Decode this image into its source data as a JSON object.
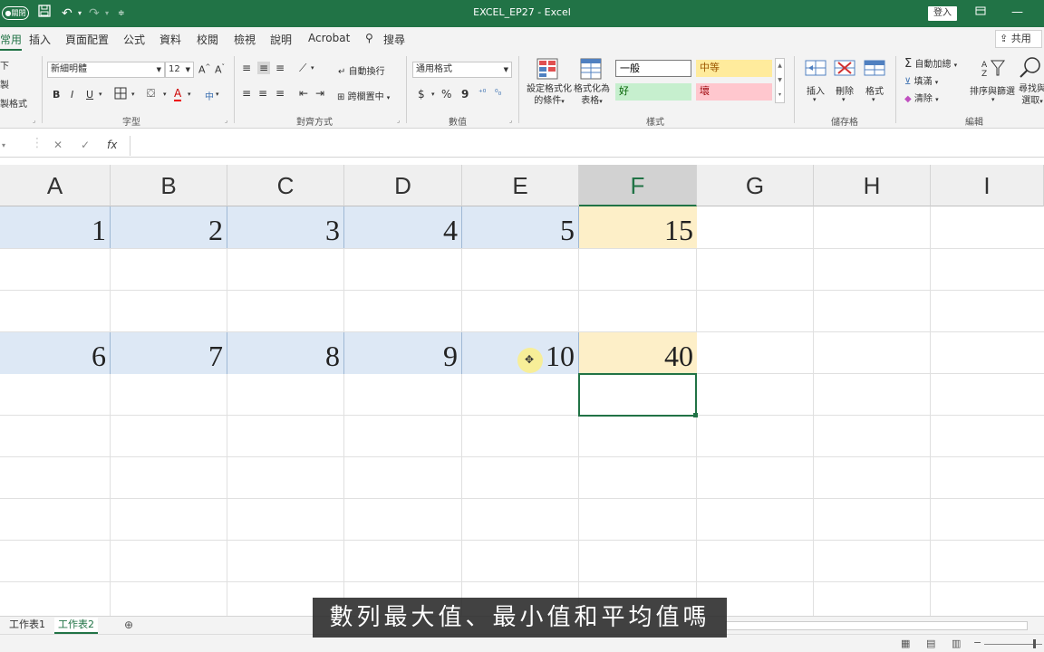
{
  "titlebar": {
    "autosave_label": "●關閉",
    "title": "EXCEL_EP27 - Excel",
    "signin": "登入"
  },
  "tabs": [
    {
      "label": "常用"
    },
    {
      "label": "插入"
    },
    {
      "label": "頁面配置"
    },
    {
      "label": "公式"
    },
    {
      "label": "資料"
    },
    {
      "label": "校閱"
    },
    {
      "label": "檢視"
    },
    {
      "label": "說明"
    },
    {
      "label": "Acrobat"
    },
    {
      "label": "搜尋"
    }
  ],
  "share_label": "共用",
  "ribbon": {
    "clipboard": {
      "paste_short": "下",
      "copy_short": "製",
      "format_painter_short": "製格式"
    },
    "font": {
      "font_name": "新細明體",
      "font_size": "12",
      "grow": "A^",
      "shrink": "A˅",
      "bold": "B",
      "italic": "I",
      "underline": "U",
      "color_a": "A",
      "phonetic": "中",
      "label": "字型"
    },
    "alignment": {
      "wrap": "自動換行",
      "merge": "跨欄置中",
      "label": "對齊方式"
    },
    "number": {
      "format": "通用格式",
      "currency": "$",
      "percent": "%",
      "comma": "9",
      "label": "數值"
    },
    "styles": {
      "conditional": [
        "設定格式化",
        "的條件"
      ],
      "as_table": [
        "格式化為",
        "表格"
      ],
      "normal": "一般",
      "neutral": "中等",
      "good": "好",
      "bad": "壞",
      "label": "樣式"
    },
    "cells": {
      "insert": "插入",
      "delete": "刪除",
      "format": "格式",
      "label": "儲存格"
    },
    "editing": {
      "autosum": "自動加總",
      "fill": "填滿",
      "clear": "清除",
      "sort_filter": "排序與篩選",
      "find_select": [
        "尋找與",
        "選取"
      ],
      "label": "編輯"
    }
  },
  "formula_bar": {
    "fx": "fx",
    "cancel": "✕",
    "enter": "✓"
  },
  "columns": [
    "A",
    "B",
    "C",
    "D",
    "E",
    "F",
    "G",
    "H",
    "I"
  ],
  "rows": {
    "row1": {
      "A": "1",
      "B": "2",
      "C": "3",
      "D": "4",
      "E": "5",
      "F": "15"
    },
    "row4": {
      "A": "6",
      "B": "7",
      "C": "8",
      "D": "9",
      "E": "10",
      "F": "40"
    }
  },
  "sheets": [
    {
      "label": "工作表1"
    },
    {
      "label": "工作表2"
    }
  ],
  "subtitle": "數列最大值、最小值和平均值嗎",
  "colors": {
    "accent": "#217346",
    "blue_fill": "#dde8f5",
    "yellow_fill": "#fdefc8"
  }
}
